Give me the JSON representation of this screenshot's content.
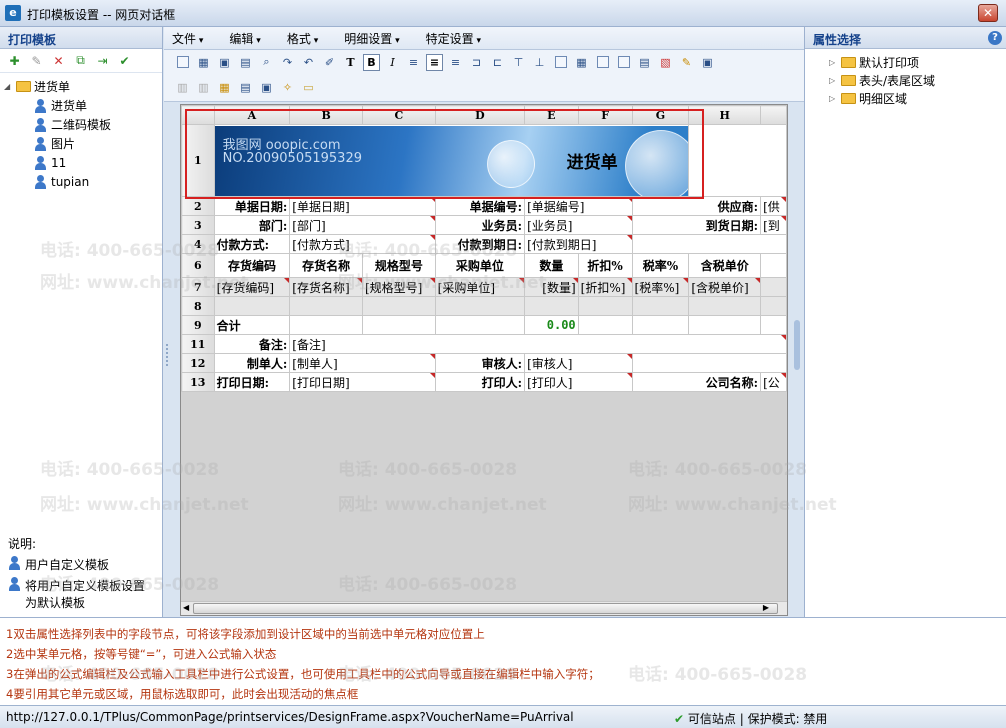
{
  "window": {
    "title": "打印模板设置 -- 网页对话框",
    "close_label": "✕"
  },
  "left_panel": {
    "title": "打印模板",
    "tree_root": "进货单",
    "tree_items": [
      "进货单",
      "二维码模板",
      "图片",
      "11",
      "tupian"
    ],
    "notes_title": "说明:",
    "note_custom": "用户自定义模板",
    "note_default_line1": "将用户自定义模板设置",
    "note_default_line2": "为默认模板"
  },
  "right_panel": {
    "title": "属性选择",
    "items": [
      "默认打印项",
      "表头/表尾区域",
      "明细区域"
    ]
  },
  "menu": {
    "items": [
      "文件",
      "编辑",
      "格式",
      "明细设置",
      "特定设置"
    ]
  },
  "sheet": {
    "columns": [
      "A",
      "B",
      "C",
      "D",
      "E",
      "F",
      "G",
      "H"
    ],
    "rows": [
      "1",
      "2",
      "3",
      "4",
      "6",
      "7",
      "8",
      "9",
      "11",
      "12",
      "13"
    ],
    "banner_wm1": "我图网 ooopic.com",
    "banner_wm2": "NO.20090505195329",
    "banner_title": "进货单",
    "r2": [
      "单据日期:",
      "[单据日期]",
      "单据编号:",
      "[单据编号]",
      "供应商:",
      "[供"
    ],
    "r3": [
      "部门:",
      "[部门]",
      "业务员:",
      "[业务员]",
      "到货日期:",
      "[到"
    ],
    "r4": [
      "付款方式:",
      "[付款方式]",
      "付款到期日:",
      "[付款到期日]"
    ],
    "r6": [
      "存货编码",
      "存货名称",
      "规格型号",
      "采购单位",
      "数量",
      "折扣%",
      "税率%",
      "含税单价"
    ],
    "r7": [
      "[存货编码]",
      "[存货名称]",
      "[规格型号]",
      "[采购单位]",
      "[数量]",
      "[折扣%]",
      "[税率%]",
      "[含税单价]"
    ],
    "r9": [
      "合计",
      "0.00"
    ],
    "r11": [
      "备注:",
      "[备注]"
    ],
    "r12": [
      "制单人:",
      "[制单人]",
      "审核人:",
      "[审核人]"
    ],
    "r13": [
      "打印日期:",
      "[打印日期]",
      "打印人:",
      "[打印人]",
      "公司名称:",
      "[公"
    ]
  },
  "help_lines": [
    "1双击属性选择列表中的字段节点，可将该字段添加到设计区域中的当前选中单元格对应位置上",
    "2选中某单元格，按等号键“=”，可进入公式输入状态",
    "3在弹出的公式编辑栏及公式输入工具栏中进行公式设置，也可使用工具栏中的公式向导或直接在编辑栏中输入字符；",
    "4要引用其它单元或区域，用鼠标选取即可，此时会出现活动的焦点框"
  ],
  "status": {
    "url": "http://127.0.0.1/TPlus/CommonPage/printservices/DesignFrame.aspx?VoucherName=PuArrival",
    "zone": "可信站点",
    "mode": "保护模式: 禁用"
  },
  "watermark": {
    "phone": "电话: 400-665-0028",
    "site": "网址: www.chanjet.net"
  },
  "colors": {
    "accent": "#15428b",
    "help_text": "#b4350f",
    "red_frame": "#d62020",
    "total_value": "#1a8a1a"
  }
}
